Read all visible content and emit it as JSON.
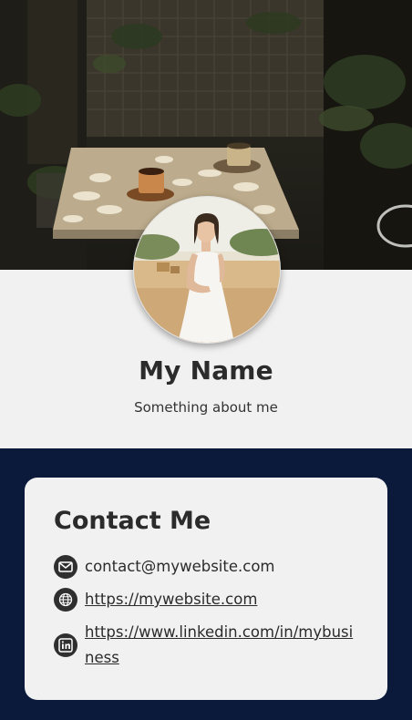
{
  "profile": {
    "name": "My Name",
    "tagline": "Something about me"
  },
  "contact": {
    "title": "Contact Me",
    "email": "contact@mywebsite.com",
    "website": "https://mywebsite.com",
    "linkedin": "https://www.linkedin.com/in/mybusiness"
  },
  "icons": {
    "email": "mail-icon",
    "website": "globe-icon",
    "linkedin": "linkedin-icon"
  },
  "colors": {
    "background_dark": "#0b1a3b",
    "card_background": "#f1f1f1",
    "text_primary": "#2b2b2b",
    "icon_circle": "#2f2f2f"
  }
}
